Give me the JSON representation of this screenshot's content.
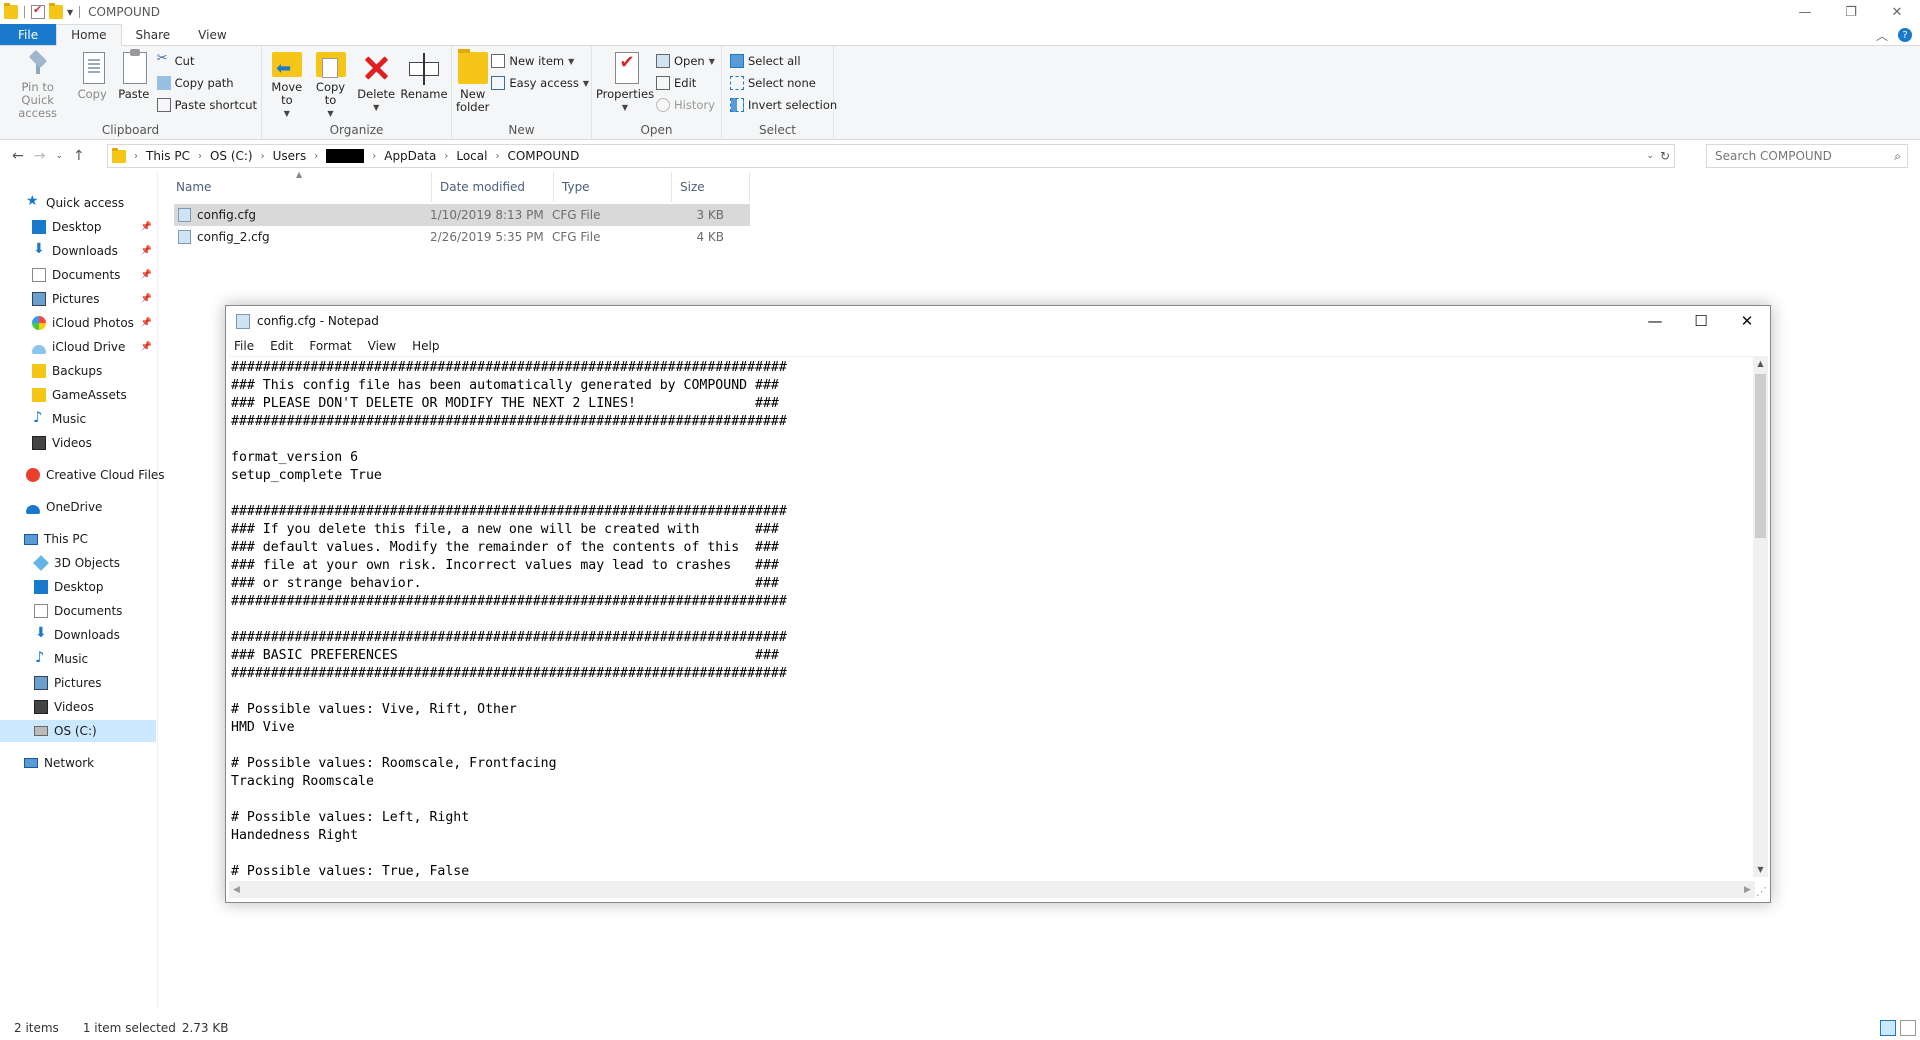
{
  "window": {
    "title": "COMPOUND"
  },
  "ribbon": {
    "tabs": [
      {
        "label": "File"
      },
      {
        "label": "Home"
      },
      {
        "label": "Share"
      },
      {
        "label": "View"
      }
    ],
    "clipboard": {
      "pin": "Pin to Quick access",
      "copy": "Copy",
      "paste": "Paste",
      "cut": "Cut",
      "copy_path": "Copy path",
      "paste_shortcut": "Paste shortcut",
      "label": "Clipboard"
    },
    "organize": {
      "move_to": "Move to",
      "copy_to": "Copy to",
      "delete": "Delete",
      "rename": "Rename",
      "label": "Organize"
    },
    "new": {
      "new_folder": "New folder",
      "new_item": "New item",
      "easy_access": "Easy access",
      "label": "New"
    },
    "open": {
      "properties": "Properties",
      "open": "Open",
      "edit": "Edit",
      "history": "History",
      "label": "Open"
    },
    "select": {
      "select_all": "Select all",
      "select_none": "Select none",
      "invert": "Invert selection",
      "label": "Select"
    }
  },
  "address": {
    "crumbs": [
      "This PC",
      "OS (C:)",
      "Users",
      "AppData",
      "Local",
      "COMPOUND"
    ]
  },
  "search": {
    "placeholder": "Search COMPOUND"
  },
  "nav": {
    "quick_access": "Quick access",
    "quick_items": [
      {
        "label": "Desktop"
      },
      {
        "label": "Downloads"
      },
      {
        "label": "Documents"
      },
      {
        "label": "Pictures"
      },
      {
        "label": "iCloud Photos"
      },
      {
        "label": "iCloud Drive"
      },
      {
        "label": "Backups"
      },
      {
        "label": "GameAssets"
      },
      {
        "label": "Music"
      },
      {
        "label": "Videos"
      }
    ],
    "creative_cloud": "Creative Cloud Files",
    "onedrive": "OneDrive",
    "this_pc": "This PC",
    "pc_items": [
      {
        "label": "3D Objects"
      },
      {
        "label": "Desktop"
      },
      {
        "label": "Documents"
      },
      {
        "label": "Downloads"
      },
      {
        "label": "Music"
      },
      {
        "label": "Pictures"
      },
      {
        "label": "Videos"
      },
      {
        "label": "OS (C:)"
      }
    ],
    "network": "Network"
  },
  "files": {
    "columns": {
      "name": "Name",
      "date": "Date modified",
      "type": "Type",
      "size": "Size"
    },
    "rows": [
      {
        "name": "config.cfg",
        "date": "1/10/2019 8:13 PM",
        "type": "CFG File",
        "size": "3 KB"
      },
      {
        "name": "config_2.cfg",
        "date": "2/26/2019 5:35 PM",
        "type": "CFG File",
        "size": "4 KB"
      }
    ]
  },
  "status": {
    "items": "2 items",
    "selected": "1 item selected",
    "size": "2.73 KB"
  },
  "notepad": {
    "title": "config.cfg - Notepad",
    "menu": [
      "File",
      "Edit",
      "Format",
      "View",
      "Help"
    ],
    "content": "######################################################################\n### This config file has been automatically generated by COMPOUND ###\n### PLEASE DON'T DELETE OR MODIFY THE NEXT 2 LINES!               ###\n######################################################################\n\nformat_version 6\nsetup_complete True\n\n######################################################################\n### If you delete this file, a new one will be created with       ###\n### default values. Modify the remainder of the contents of this  ###\n### file at your own risk. Incorrect values may lead to crashes   ###\n### or strange behavior.                                          ###\n######################################################################\n\n######################################################################\n### BASIC PREFERENCES                                             ###\n######################################################################\n\n# Possible values: Vive, Rift, Other\nHMD Vive\n\n# Possible values: Roomscale, Frontfacing\nTracking Roomscale\n\n# Possible values: Left, Right\nHandedness Right\n\n# Possible values: True, False"
  }
}
